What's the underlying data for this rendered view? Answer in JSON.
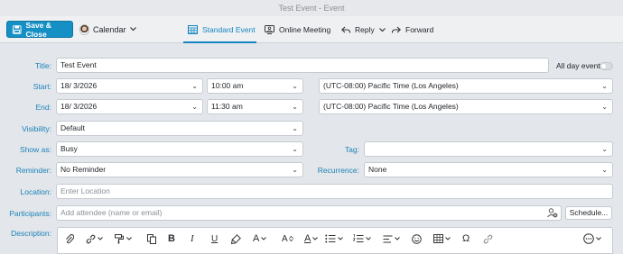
{
  "window": {
    "title": "Test Event - Event"
  },
  "toolbar": {
    "save_close": "Save & Close",
    "calendar": "Calendar",
    "standard_event": "Standard Event",
    "online_meeting": "Online Meeting",
    "reply": "Reply",
    "forward": "Forward"
  },
  "form": {
    "title_label": "Title:",
    "title_value": "Test Event",
    "all_day_label": "All day event",
    "all_day_on": false,
    "start_label": "Start:",
    "start_date": "18/  3/2026",
    "start_time": "10:00 am",
    "start_tz": "(UTC-08:00) Pacific Time (Los Angeles)",
    "end_label": "End:",
    "end_date": "18/  3/2026",
    "end_time": "11:30 am",
    "end_tz": "(UTC-08:00) Pacific Time (Los Angeles)",
    "visibility_label": "Visibility:",
    "visibility_value": "Default",
    "show_as_label": "Show as:",
    "show_as_value": "Busy",
    "tag_label": "Tag:",
    "tag_value": "",
    "reminder_label": "Reminder:",
    "reminder_value": "No Reminder",
    "recurrence_label": "Recurrence:",
    "recurrence_value": "None",
    "location_label": "Location:",
    "location_placeholder": "Enter Location",
    "participants_label": "Participants:",
    "participants_placeholder": "Add attendee (name or email)",
    "schedule_button": "Schedule...",
    "description_label": "Description:"
  },
  "editor_toolbar": {
    "bold": "B",
    "italic": "I",
    "underline": "U",
    "font": "A",
    "font_size": "A",
    "font_color": "A",
    "special_char": "Ω"
  },
  "colors": {
    "accent": "#1590c5",
    "label": "#1b83b8"
  }
}
